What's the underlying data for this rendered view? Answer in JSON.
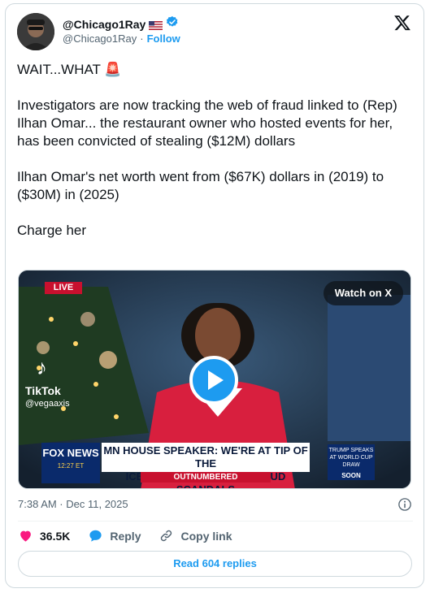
{
  "author": {
    "display_name": "@Chicago1Ray",
    "handle": "@Chicago1Ray",
    "separator": "·",
    "follow_label": "Follow",
    "verified_color": "#1d9bf0"
  },
  "tweet": {
    "paragraphs": [
      "WAIT...WHAT 🚨",
      "Investigators are now tracking the web of fraud linked to (Rep) Ilhan Omar... the restaurant owner who hosted events for her, has been convicted of stealing ($12M) dollars",
      "Ilhan Omar's net worth went from ($67K) dollars in (2019) to ($30M) in (2025)",
      "Charge her"
    ]
  },
  "media": {
    "watch_label": "Watch on X",
    "live_tag": "LIVE",
    "tiktok_label": "TikTok",
    "tiktok_handle": "@vegaaxis",
    "network": "FOX NEWS",
    "network_time": "12:27 ET",
    "chyron_line1": "MN HOUSE SPEAKER: WE'RE AT TIP OF THE",
    "chyron_line2": "ICEBERG IN WALZ-ERA FRAUD SCANDALS",
    "show_name": "OUTNUMBERED",
    "side_promo": "TRUMP SPEAKS AT WORLD CUP DRAW",
    "side_soon": "SOON"
  },
  "meta": {
    "timestamp": "7:38 AM · Dec 11, 2025"
  },
  "actions": {
    "likes": "36.5K",
    "reply_label": "Reply",
    "copy_link_label": "Copy link",
    "like_color": "#f91880"
  },
  "replies_button": "Read 604 replies"
}
